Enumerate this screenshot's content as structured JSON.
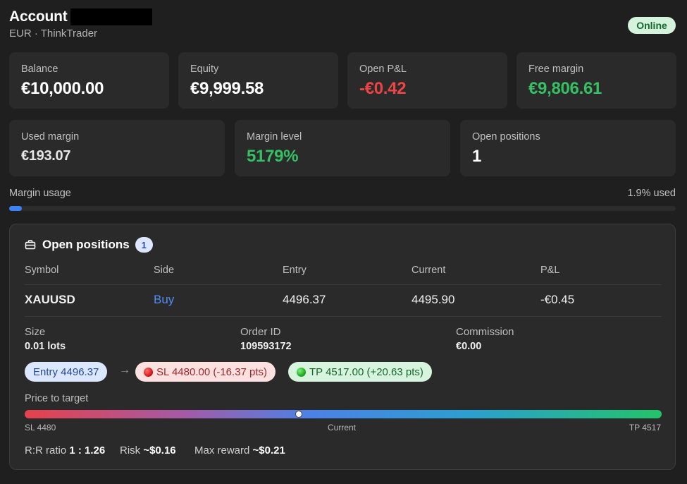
{
  "header": {
    "title": "Account",
    "subtitle": "EUR · ThinkTrader",
    "status": "Online"
  },
  "cards": {
    "balance": {
      "label": "Balance",
      "value": "€10,000.00"
    },
    "equity": {
      "label": "Equity",
      "value": "€9,999.58"
    },
    "open_pl": {
      "label": "Open P&L",
      "value": "-€0.42"
    },
    "free_margin": {
      "label": "Free margin",
      "value": "€9,806.61"
    },
    "used_margin": {
      "label": "Used margin",
      "value": "€193.07"
    },
    "margin_level": {
      "label": "Margin level",
      "value": "5179%"
    },
    "open_positions": {
      "label": "Open positions",
      "value": "1"
    }
  },
  "margin_usage": {
    "label": "Margin usage",
    "used_text": "1.9% used",
    "fraction": 0.019
  },
  "positions": {
    "title": "Open positions",
    "count": "1",
    "columns": [
      "Symbol",
      "Side",
      "Entry",
      "Current",
      "P&L"
    ],
    "rows": [
      [
        "XAUUSD",
        "Buy",
        "4496.37",
        "4495.90",
        "-€0.45"
      ]
    ],
    "details": {
      "size_label": "Size",
      "size_value": "0.01 lots",
      "order_label": "Order ID",
      "order_value": "109593172",
      "commission_label": "Commission",
      "commission_value": "€0.00"
    },
    "pills": {
      "entry": "Entry 4496.37",
      "sl": "SL 4480.00 (-16.37 pts)",
      "tp": "TP 4517.00 (+20.63 pts)"
    },
    "price_to_target": {
      "label": "Price to target",
      "sl_tick": "SL 4480",
      "current_tick": "Current",
      "tp_tick": "TP 4517",
      "progress": 0.43
    },
    "summary": {
      "rr_label": "R:R ratio",
      "rr_value": "1 : 1.26",
      "risk_label": "Risk",
      "risk_value": "~$0.16",
      "reward_label": "Max reward",
      "reward_value": "~$0.21"
    }
  },
  "colors": {
    "background": "#1f1f1f",
    "card": "#2a2a2a",
    "negative": "#ef4444",
    "positive": "#34c063",
    "accent": "#3b82f6",
    "online_badge": "#d5f3dc"
  },
  "icons": {
    "positions_title": "briefcase-icon",
    "flow_arrow": "arrow-right-icon"
  }
}
